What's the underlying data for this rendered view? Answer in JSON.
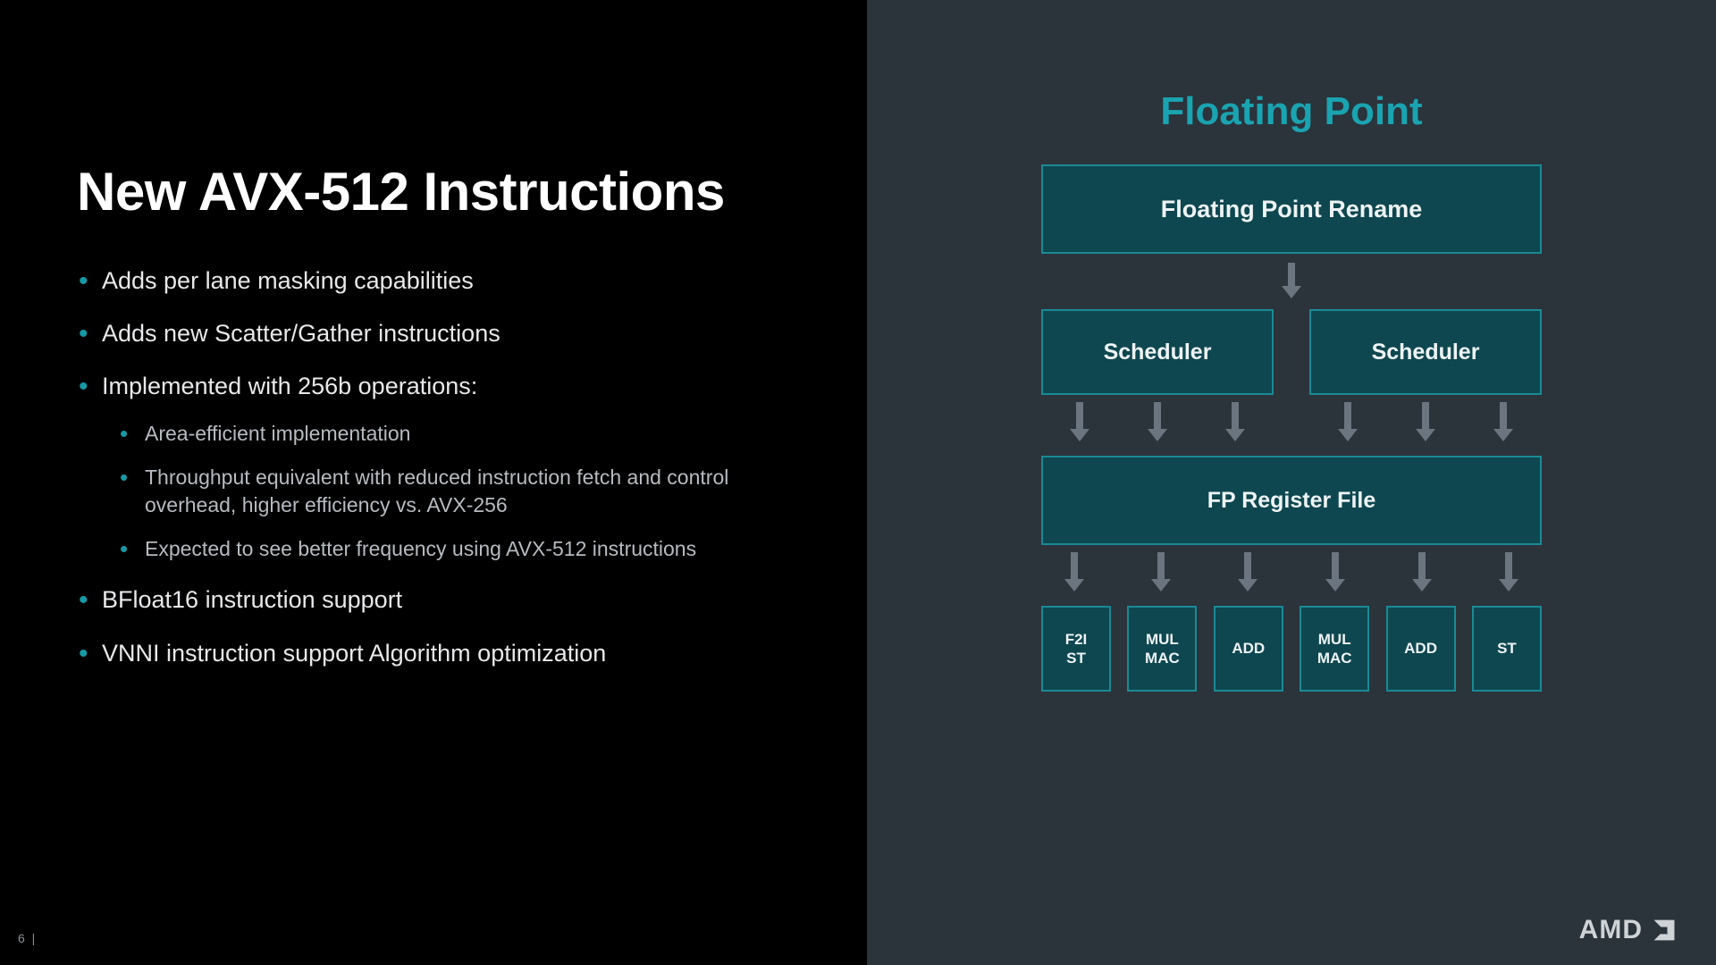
{
  "slide": {
    "title": "New AVX-512 Instructions",
    "bullets": [
      {
        "text": "Adds per lane masking capabilities"
      },
      {
        "text": "Adds new Scatter/Gather instructions"
      },
      {
        "text": "Implemented with 256b operations:",
        "sub": [
          "Area-efficient implementation",
          "Throughput equivalent with reduced instruction fetch and control overhead, higher efficiency vs. AVX-256",
          "Expected to see better frequency using AVX-512 instructions"
        ]
      },
      {
        "text": "BFloat16 instruction support"
      },
      {
        "text": "VNNI instruction support Algorithm optimization"
      }
    ],
    "page_number": "6    |"
  },
  "diagram": {
    "title": "Floating Point",
    "rename": "Floating Point Rename",
    "scheduler_left": "Scheduler",
    "scheduler_right": "Scheduler",
    "regfile": "FP Register File",
    "units": [
      "F2I\nST",
      "MUL\nMAC",
      "ADD",
      "MUL\nMAC",
      "ADD",
      "ST"
    ]
  },
  "brand": {
    "name": "AMD"
  }
}
